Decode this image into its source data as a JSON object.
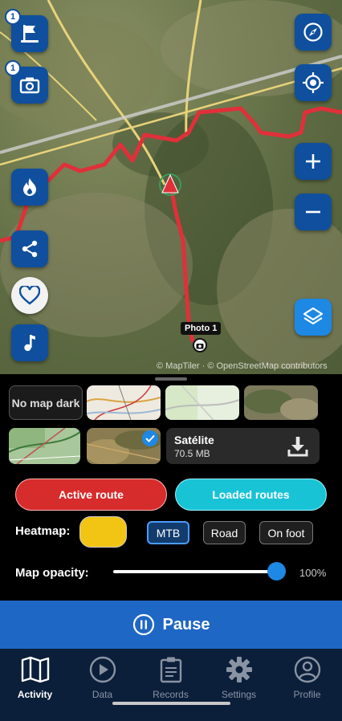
{
  "map": {
    "left_buttons": [
      {
        "name": "flag-icon",
        "badge": "1"
      },
      {
        "name": "camera-icon",
        "badge": "1"
      },
      {
        "name": "fire-icon"
      },
      {
        "name": "share-icon"
      },
      {
        "name": "heart-icon"
      },
      {
        "name": "music-note-icon"
      }
    ],
    "right_buttons": [
      "compass-icon",
      "locate-icon",
      "plus-icon",
      "minus-icon",
      "layers-icon"
    ],
    "photo_label": "Photo 1",
    "attribution": "© MapTiler · © OpenStreetMap contributors"
  },
  "layers": {
    "dark_label": "No map dark",
    "selected": "Satélite",
    "download": {
      "name": "Satélite",
      "size": "70.5 MB"
    }
  },
  "routes": {
    "active": "Active route",
    "loaded": "Loaded routes"
  },
  "heatmap": {
    "label": "Heatmap:",
    "color": "#f2c414",
    "options": [
      "MTB",
      "Road",
      "On foot"
    ],
    "selected": "MTB"
  },
  "opacity": {
    "label": "Map opacity:",
    "value_text": "100%",
    "value": 1.0
  },
  "pause": {
    "label": "Pause"
  },
  "tabs": [
    {
      "label": "Activity",
      "active": true
    },
    {
      "label": "Data",
      "active": false
    },
    {
      "label": "Records",
      "active": false
    },
    {
      "label": "Settings",
      "active": false
    },
    {
      "label": "Profile",
      "active": false
    }
  ],
  "colors": {
    "accent": "#0f4f9e",
    "route": "#d62c2c",
    "loaded": "#19c3d6",
    "pause_bg": "#1f67c4",
    "tabbar_bg": "#0b1f3a"
  }
}
